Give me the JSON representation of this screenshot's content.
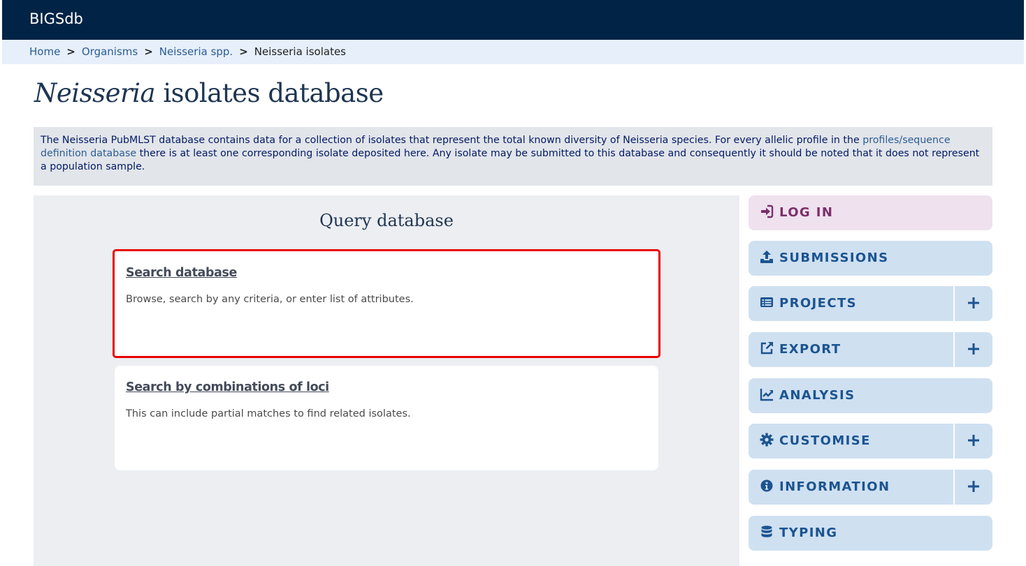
{
  "header": {
    "brand": "BIGSdb"
  },
  "breadcrumb": {
    "items": [
      {
        "label": "Home"
      },
      {
        "label": "Organisms"
      },
      {
        "label": "Neisseria spp."
      }
    ],
    "separator": ">",
    "current": "Neisseria isolates"
  },
  "page": {
    "title_italic": "Neisseria",
    "title_rest": " isolates database"
  },
  "description": {
    "text_before": "The Neisseria PubMLST database contains data for a collection of isolates that represent the total known diversity of Neisseria species. For every allelic profile in the ",
    "link": "profiles/sequence definition database",
    "text_after": " there is at least one corresponding isolate deposited here. Any isolate may be submitted to this database and consequently it should be noted that it does not represent a population sample."
  },
  "query": {
    "title": "Query database",
    "cards": [
      {
        "link": "Search database",
        "desc": "Browse, search by any criteria, or enter list of attributes."
      },
      {
        "link": "Search by combinations of loci",
        "desc": "This can include partial matches to find related isolates."
      }
    ]
  },
  "menu": {
    "login": {
      "label": "LOG IN",
      "icon": "sign-in-icon"
    },
    "submissions": {
      "label": "SUBMISSIONS",
      "icon": "upload-icon"
    },
    "projects": {
      "label": "PROJECTS",
      "icon": "list-icon",
      "expand": "+"
    },
    "export": {
      "label": "EXPORT",
      "icon": "external-link-icon",
      "expand": "+"
    },
    "analysis": {
      "label": "ANALYSIS",
      "icon": "chart-line-icon"
    },
    "customise": {
      "label": "CUSTOMISE",
      "icon": "gear-icon",
      "expand": "+"
    },
    "information": {
      "label": "INFORMATION",
      "icon": "info-circle-icon",
      "expand": "+"
    },
    "typing": {
      "label": "TYPING",
      "icon": "database-icon"
    }
  },
  "colors": {
    "header_bg": "#012345",
    "breadcrumb_bg": "#e6effa",
    "menu_bg": "#cfe0f1",
    "login_bg": "#efe1ee",
    "highlight": "#e80000"
  }
}
